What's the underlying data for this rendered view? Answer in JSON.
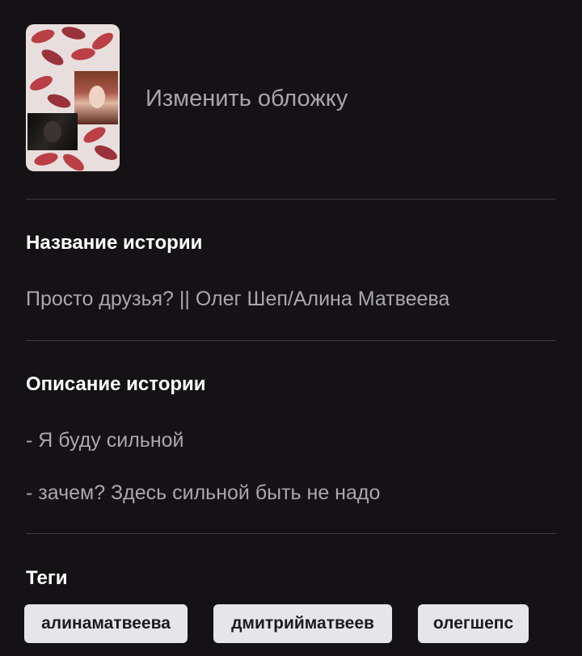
{
  "cover": {
    "change_label": "Изменить обложку",
    "accent_color": "#b3232c"
  },
  "title_section": {
    "label": "Название истории",
    "value": "Просто друзья? || Олег Шеп/Алина Матвеева"
  },
  "description_section": {
    "label": "Описание истории",
    "lines": [
      "- Я буду сильной",
      "- зачем? Здесь сильной быть не надо"
    ]
  },
  "tags_section": {
    "label": "Теги",
    "tags": [
      "алинаматвеева",
      "дмитрийматвеев",
      "олегшепс"
    ]
  },
  "colors": {
    "background": "#141215",
    "muted_text": "#aaa7ad",
    "tag_background": "#e6e6e8"
  }
}
